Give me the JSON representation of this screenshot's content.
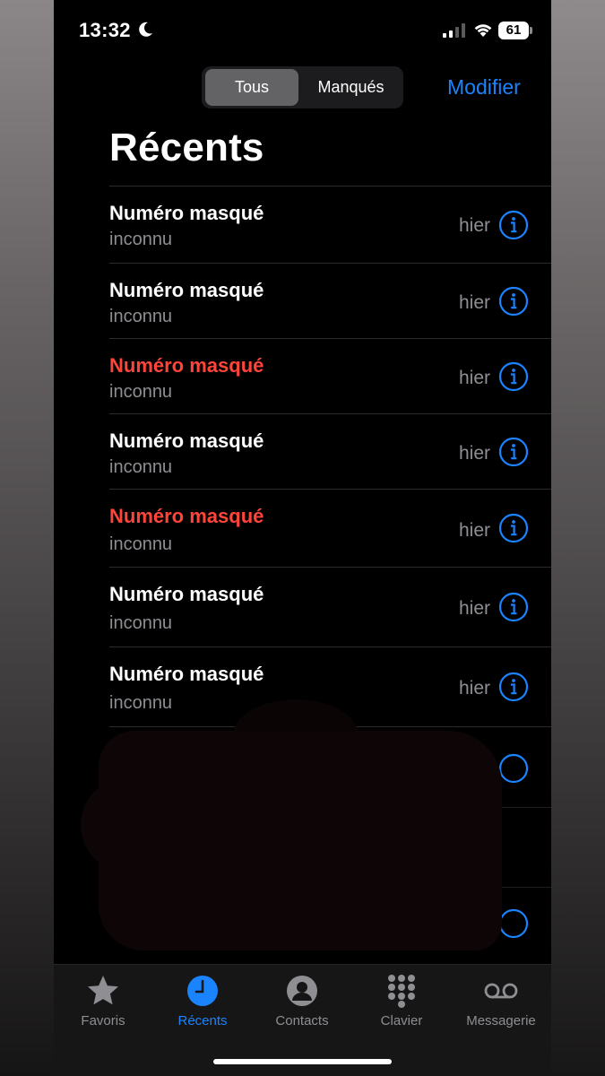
{
  "status_bar": {
    "time": "13:32",
    "battery": "61"
  },
  "filter": {
    "all_label": "Tous",
    "missed_label": "Manqués",
    "selected": "Tous"
  },
  "edit_label": "Modifier",
  "title": "Récents",
  "calls": [
    {
      "name": "Numéro masqué",
      "label": "inconnu",
      "time": "hier",
      "missed": false
    },
    {
      "name": "Numéro masqué",
      "label": "inconnu",
      "time": "hier",
      "missed": false
    },
    {
      "name": "Numéro masqué",
      "label": "inconnu",
      "time": "hier",
      "missed": true
    },
    {
      "name": "Numéro masqué",
      "label": "inconnu",
      "time": "hier",
      "missed": false
    },
    {
      "name": "Numéro masqué",
      "label": "inconnu",
      "time": "hier",
      "missed": true
    },
    {
      "name": "Numéro masqué",
      "label": "inconnu",
      "time": "hier",
      "missed": false
    },
    {
      "name": "Numéro masqué",
      "label": "inconnu",
      "time": "hier",
      "missed": false
    }
  ],
  "tabs": [
    {
      "label": "Favoris",
      "icon": "star-icon",
      "active": false
    },
    {
      "label": "Récents",
      "icon": "clock-icon",
      "active": true
    },
    {
      "label": "Contacts",
      "icon": "person-icon",
      "active": false
    },
    {
      "label": "Clavier",
      "icon": "keypad-icon",
      "active": false
    },
    {
      "label": "Messagerie",
      "icon": "voicemail-icon",
      "active": false
    }
  ],
  "colors": {
    "accent": "#1a84ff",
    "missed": "#ff453a",
    "secondary_text": "#8e8e93"
  }
}
